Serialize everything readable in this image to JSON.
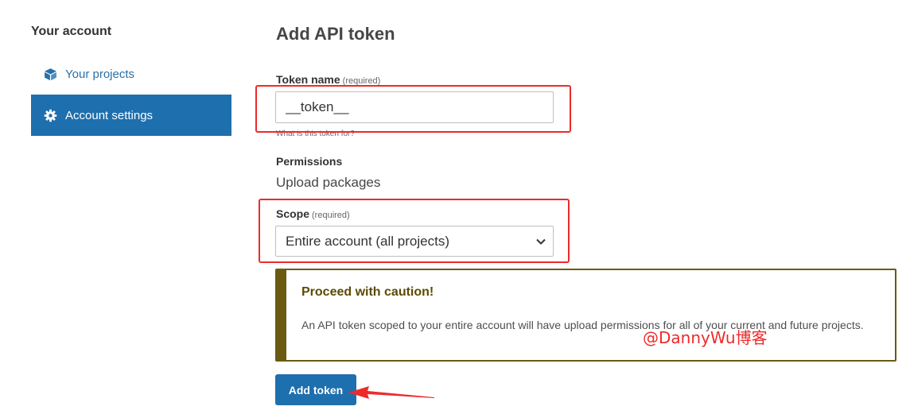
{
  "sidebar": {
    "heading": "Your account",
    "items": [
      {
        "label": "Your projects",
        "icon": "cube-icon"
      },
      {
        "label": "Account settings",
        "icon": "gear-icon"
      }
    ]
  },
  "main": {
    "title": "Add API token",
    "token_name": {
      "label": "Token name",
      "required_note": "(required)",
      "value": "__token__",
      "help": "What is this token for?"
    },
    "permissions": {
      "label": "Permissions",
      "value": "Upload packages"
    },
    "scope": {
      "label": "Scope",
      "required_note": "(required)",
      "selected": "Entire account (all projects)"
    },
    "caution": {
      "title": "Proceed with caution!",
      "body": "An API token scoped to your entire account will have upload permissions for all of your current and future projects."
    },
    "submit_label": "Add token"
  },
  "watermark": "@DannyWu博客",
  "colors": {
    "primary": "#1e6fad",
    "annotation_red": "#ee2a2a",
    "caution_border": "#6b5a12"
  }
}
